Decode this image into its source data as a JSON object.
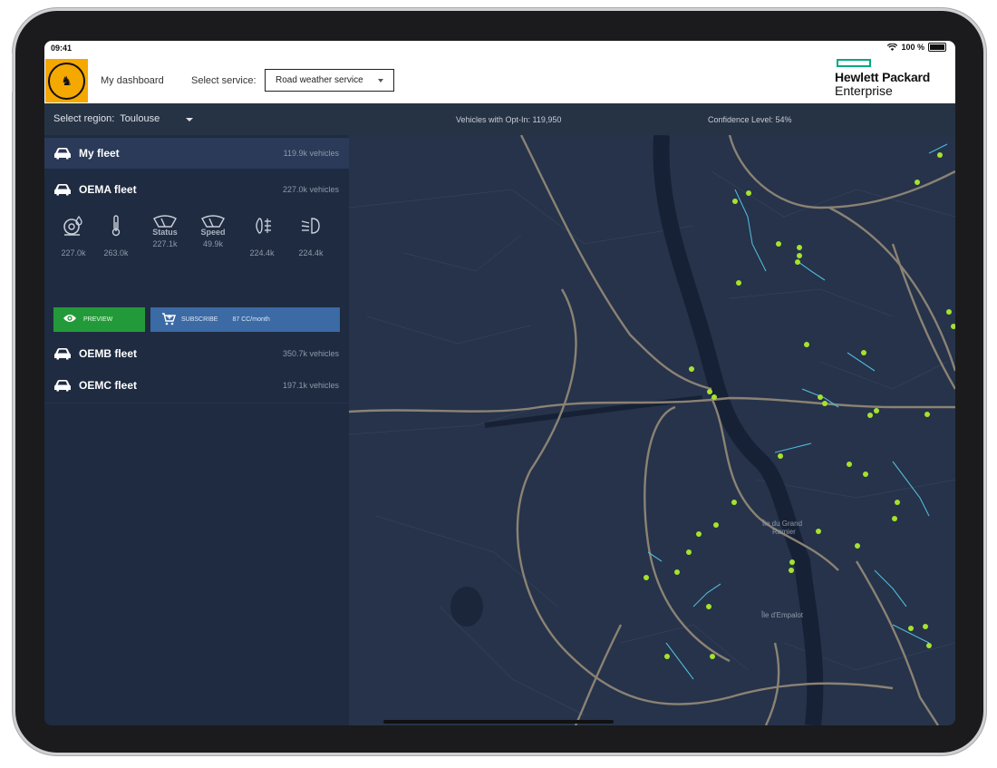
{
  "status_bar": {
    "time": "09:41",
    "battery": "100 %"
  },
  "header": {
    "my_dashboard": "My dashboard",
    "select_service_label": "Select service:",
    "service_value": "Road weather service",
    "brand_line1": "Hewlett Packard",
    "brand_line2": "Enterprise",
    "brand_color": "#01a982"
  },
  "region_bar": {
    "region_label": "Select region:",
    "region_value": "Toulouse",
    "opt_in": "Vehicles with Opt-In: 119,950",
    "confidence": "Confidence Level: 54%"
  },
  "fleets": [
    {
      "name": "My fleet",
      "count": "119.9k vehicles"
    },
    {
      "name": "OEMA fleet",
      "count": "227.0k vehicles"
    },
    {
      "name": "OEMB fleet",
      "count": "350.7k vehicles"
    },
    {
      "name": "OEMC fleet",
      "count": "197.1k vehicles"
    }
  ],
  "metrics": [
    {
      "icon": "wet-road-icon",
      "label": "",
      "value": "227.0k"
    },
    {
      "icon": "thermometer-icon",
      "label": "",
      "value": "263.0k"
    },
    {
      "icon": "wiper-icon",
      "label": "Status",
      "value": "227.1k"
    },
    {
      "icon": "wiper-icon",
      "label": "Speed",
      "value": "49.9k"
    },
    {
      "icon": "fog-light-icon",
      "label": "",
      "value": "224.4k"
    },
    {
      "icon": "headlight-icon",
      "label": "",
      "value": "224.4k"
    }
  ],
  "buttons": {
    "preview": "PREVIEW",
    "subscribe": "SUBSCRIBE",
    "subscribe_cost": "87 CC/month"
  },
  "map": {
    "labels": [
      "Île du Grand Ramier",
      "Île d'Empalot"
    ],
    "marker_color": "#a6e22e",
    "road_color": "#8b8274",
    "river_color": "#172135"
  },
  "colors": {
    "accent_brand": "#f5a800",
    "preview_green": "#239a3a",
    "subscribe_blue": "#3b6aa5",
    "sidebar_bg": "#1f2b41",
    "selected_row": "#2a3a58"
  }
}
